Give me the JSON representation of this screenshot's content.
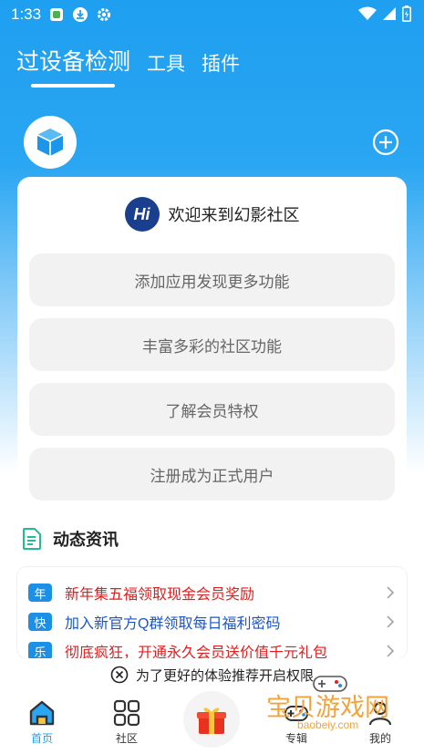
{
  "status_bar": {
    "time": "1:33",
    "icons": [
      "app-notification-icon",
      "download-icon",
      "gear-icon"
    ],
    "right_icons": [
      "wifi-icon",
      "signal-icon",
      "battery-icon"
    ]
  },
  "header": {
    "tabs": [
      {
        "label": "过设备检测",
        "active": true
      },
      {
        "label": "工具",
        "active": false
      },
      {
        "label": "插件",
        "active": false
      }
    ]
  },
  "card": {
    "welcome_badge": "Hi",
    "welcome_text": "欢迎来到幻影社区",
    "buttons": [
      "添加应用发现更多功能",
      "丰富多彩的社区功能",
      "了解会员特权",
      "注册成为正式用户"
    ]
  },
  "news": {
    "title": "动态资讯",
    "items": [
      {
        "tag": "年",
        "text": "新年集五福领取现金会员奖励",
        "color": "#e02020"
      },
      {
        "tag": "快",
        "text": "加入新官方Q群领取每日福利密码",
        "color": "#1a56c9"
      },
      {
        "tag": "乐",
        "text": "彻底疯狂，开通永久会员送价值千元礼包",
        "color": "#e02020"
      }
    ]
  },
  "permission_bar": {
    "text": "为了更好的体验推荐开启权限"
  },
  "bottom_nav": {
    "items": [
      {
        "label": "首页",
        "icon": "home-icon",
        "active": true
      },
      {
        "label": "社区",
        "icon": "grid-icon",
        "active": false
      },
      {
        "label": "",
        "icon": "gift-icon",
        "active": false
      },
      {
        "label": "专辑",
        "icon": "gamepad-icon",
        "active": false
      },
      {
        "label": "我的",
        "icon": "profile-icon",
        "active": false
      }
    ]
  },
  "watermark": {
    "text": "宝贝游戏网",
    "url": "baobeiy.com"
  },
  "colors": {
    "primary": "#1e9ff0",
    "tag_blue": "#1c8fe6",
    "news_red": "#e02020",
    "news_blue": "#1a56c9",
    "watermark": "#f2a33a"
  }
}
